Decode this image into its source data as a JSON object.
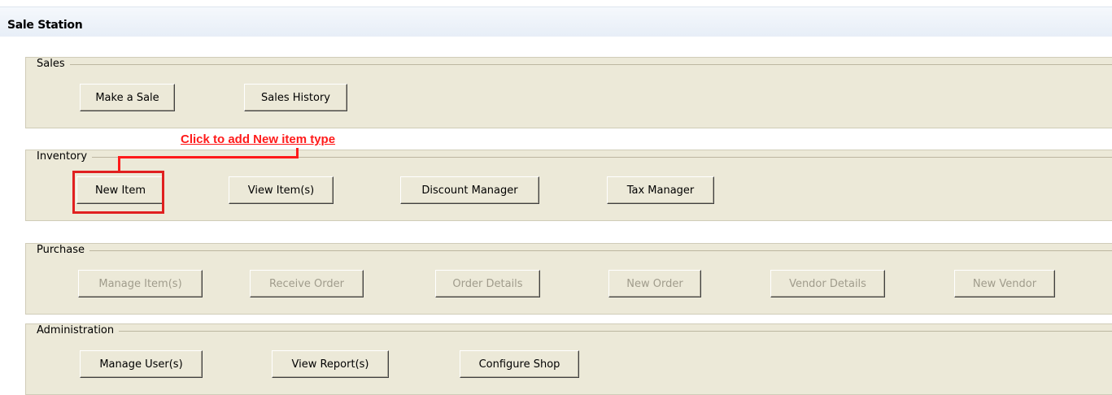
{
  "header": {
    "title": "Sale Station"
  },
  "annotation": {
    "text": "Click to add New item type",
    "color": "#ff1a1a"
  },
  "groups": {
    "sales": {
      "label": "Sales",
      "buttons": [
        "Make a Sale",
        "Sales History"
      ]
    },
    "inventory": {
      "label": "Inventory",
      "buttons": [
        "New Item",
        "View Item(s)",
        "Discount Manager",
        "Tax Manager"
      ]
    },
    "purchase": {
      "label": "Purchase",
      "disabled": true,
      "buttons": [
        "Manage Item(s)",
        "Receive Order",
        "Order Details",
        "New Order",
        "Vendor Details",
        "New Vendor"
      ]
    },
    "administration": {
      "label": "Administration",
      "buttons": [
        "Manage User(s)",
        "View Report(s)",
        "Configure Shop"
      ]
    }
  },
  "colors": {
    "panel": "#ece9d8",
    "header": "#e7eef7",
    "disabled_text": "#a09c8c"
  }
}
